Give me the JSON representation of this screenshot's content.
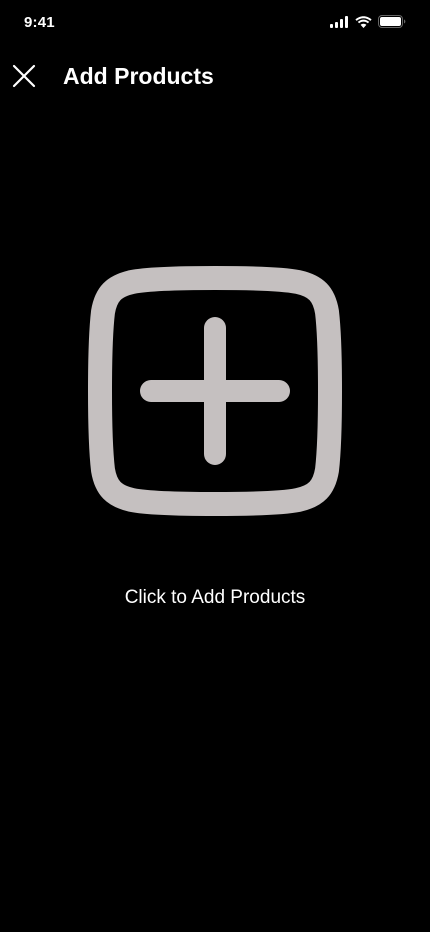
{
  "status_bar": {
    "time": "9:41"
  },
  "header": {
    "title": "Add Products",
    "close_icon": "close-icon"
  },
  "main": {
    "add_icon": "plus-square-icon",
    "add_label": "Click to Add Products"
  },
  "colors": {
    "background": "#000000",
    "text": "#ffffff",
    "icon": "#c5c0c0"
  }
}
